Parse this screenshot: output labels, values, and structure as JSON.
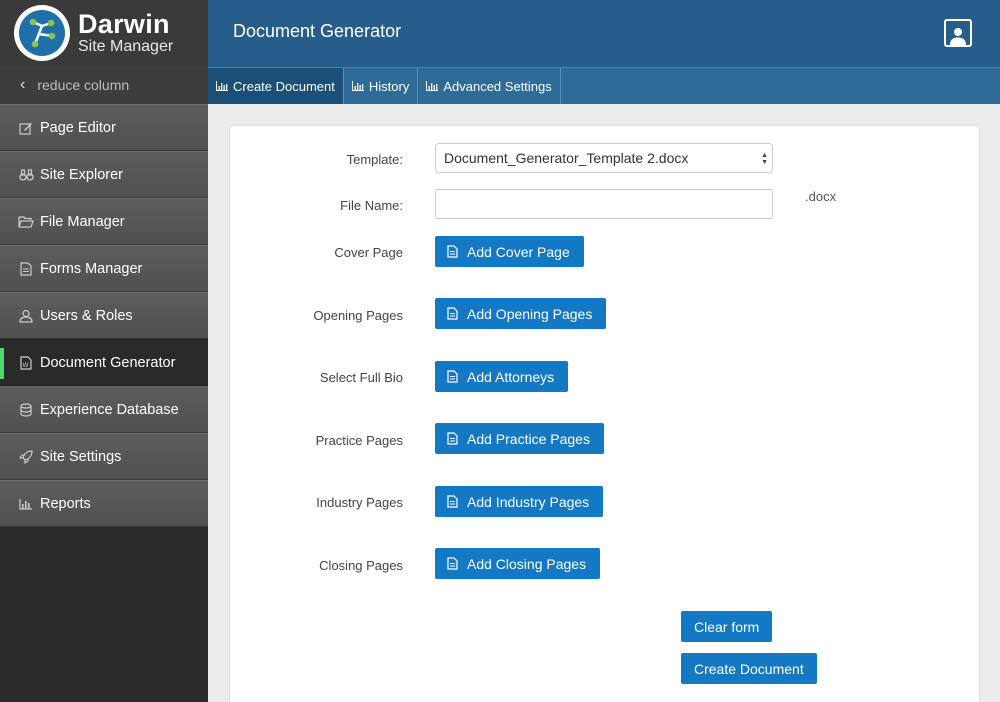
{
  "brand": {
    "title": "Darwin",
    "subtitle": "Site Manager"
  },
  "sidebar": {
    "reduce_label": "reduce column",
    "items": [
      {
        "label": "Page Editor",
        "icon": "pencil-square-icon"
      },
      {
        "label": "Site Explorer",
        "icon": "binoculars-icon"
      },
      {
        "label": "File Manager",
        "icon": "folder-open-icon"
      },
      {
        "label": "Forms Manager",
        "icon": "document-icon"
      },
      {
        "label": "Users & Roles",
        "icon": "user-icon"
      },
      {
        "label": "Document Generator",
        "icon": "word-file-icon",
        "active": true
      },
      {
        "label": "Experience Database",
        "icon": "database-icon"
      },
      {
        "label": "Site Settings",
        "icon": "rocket-icon"
      },
      {
        "label": "Reports",
        "icon": "bar-chart-icon"
      }
    ]
  },
  "header": {
    "title": "Document Generator"
  },
  "tabs": [
    {
      "label": "Create Document",
      "active": true
    },
    {
      "label": "History"
    },
    {
      "label": "Advanced Settings"
    }
  ],
  "form": {
    "template_label": "Template:",
    "template_value": "Document_Generator_Template 2.docx",
    "filename_label": "File Name:",
    "filename_value": "",
    "filename_suffix": ".docx",
    "rows": [
      {
        "label": "Cover Page",
        "button": "Add Cover Page"
      },
      {
        "label": "Opening Pages",
        "button": "Add Opening Pages"
      },
      {
        "label": "Select Full Bio",
        "button": "Add Attorneys"
      },
      {
        "label": "Practice Pages",
        "button": "Add Practice Pages"
      },
      {
        "label": "Industry Pages",
        "button": "Add Industry Pages"
      },
      {
        "label": "Closing Pages",
        "button": "Add Closing Pages"
      }
    ],
    "clear_label": "Clear form",
    "create_label": "Create Document"
  },
  "colors": {
    "header": "#265e89",
    "tabs": "#2f6b98",
    "button": "#1479c4",
    "active_indicator": "#4cd964"
  }
}
